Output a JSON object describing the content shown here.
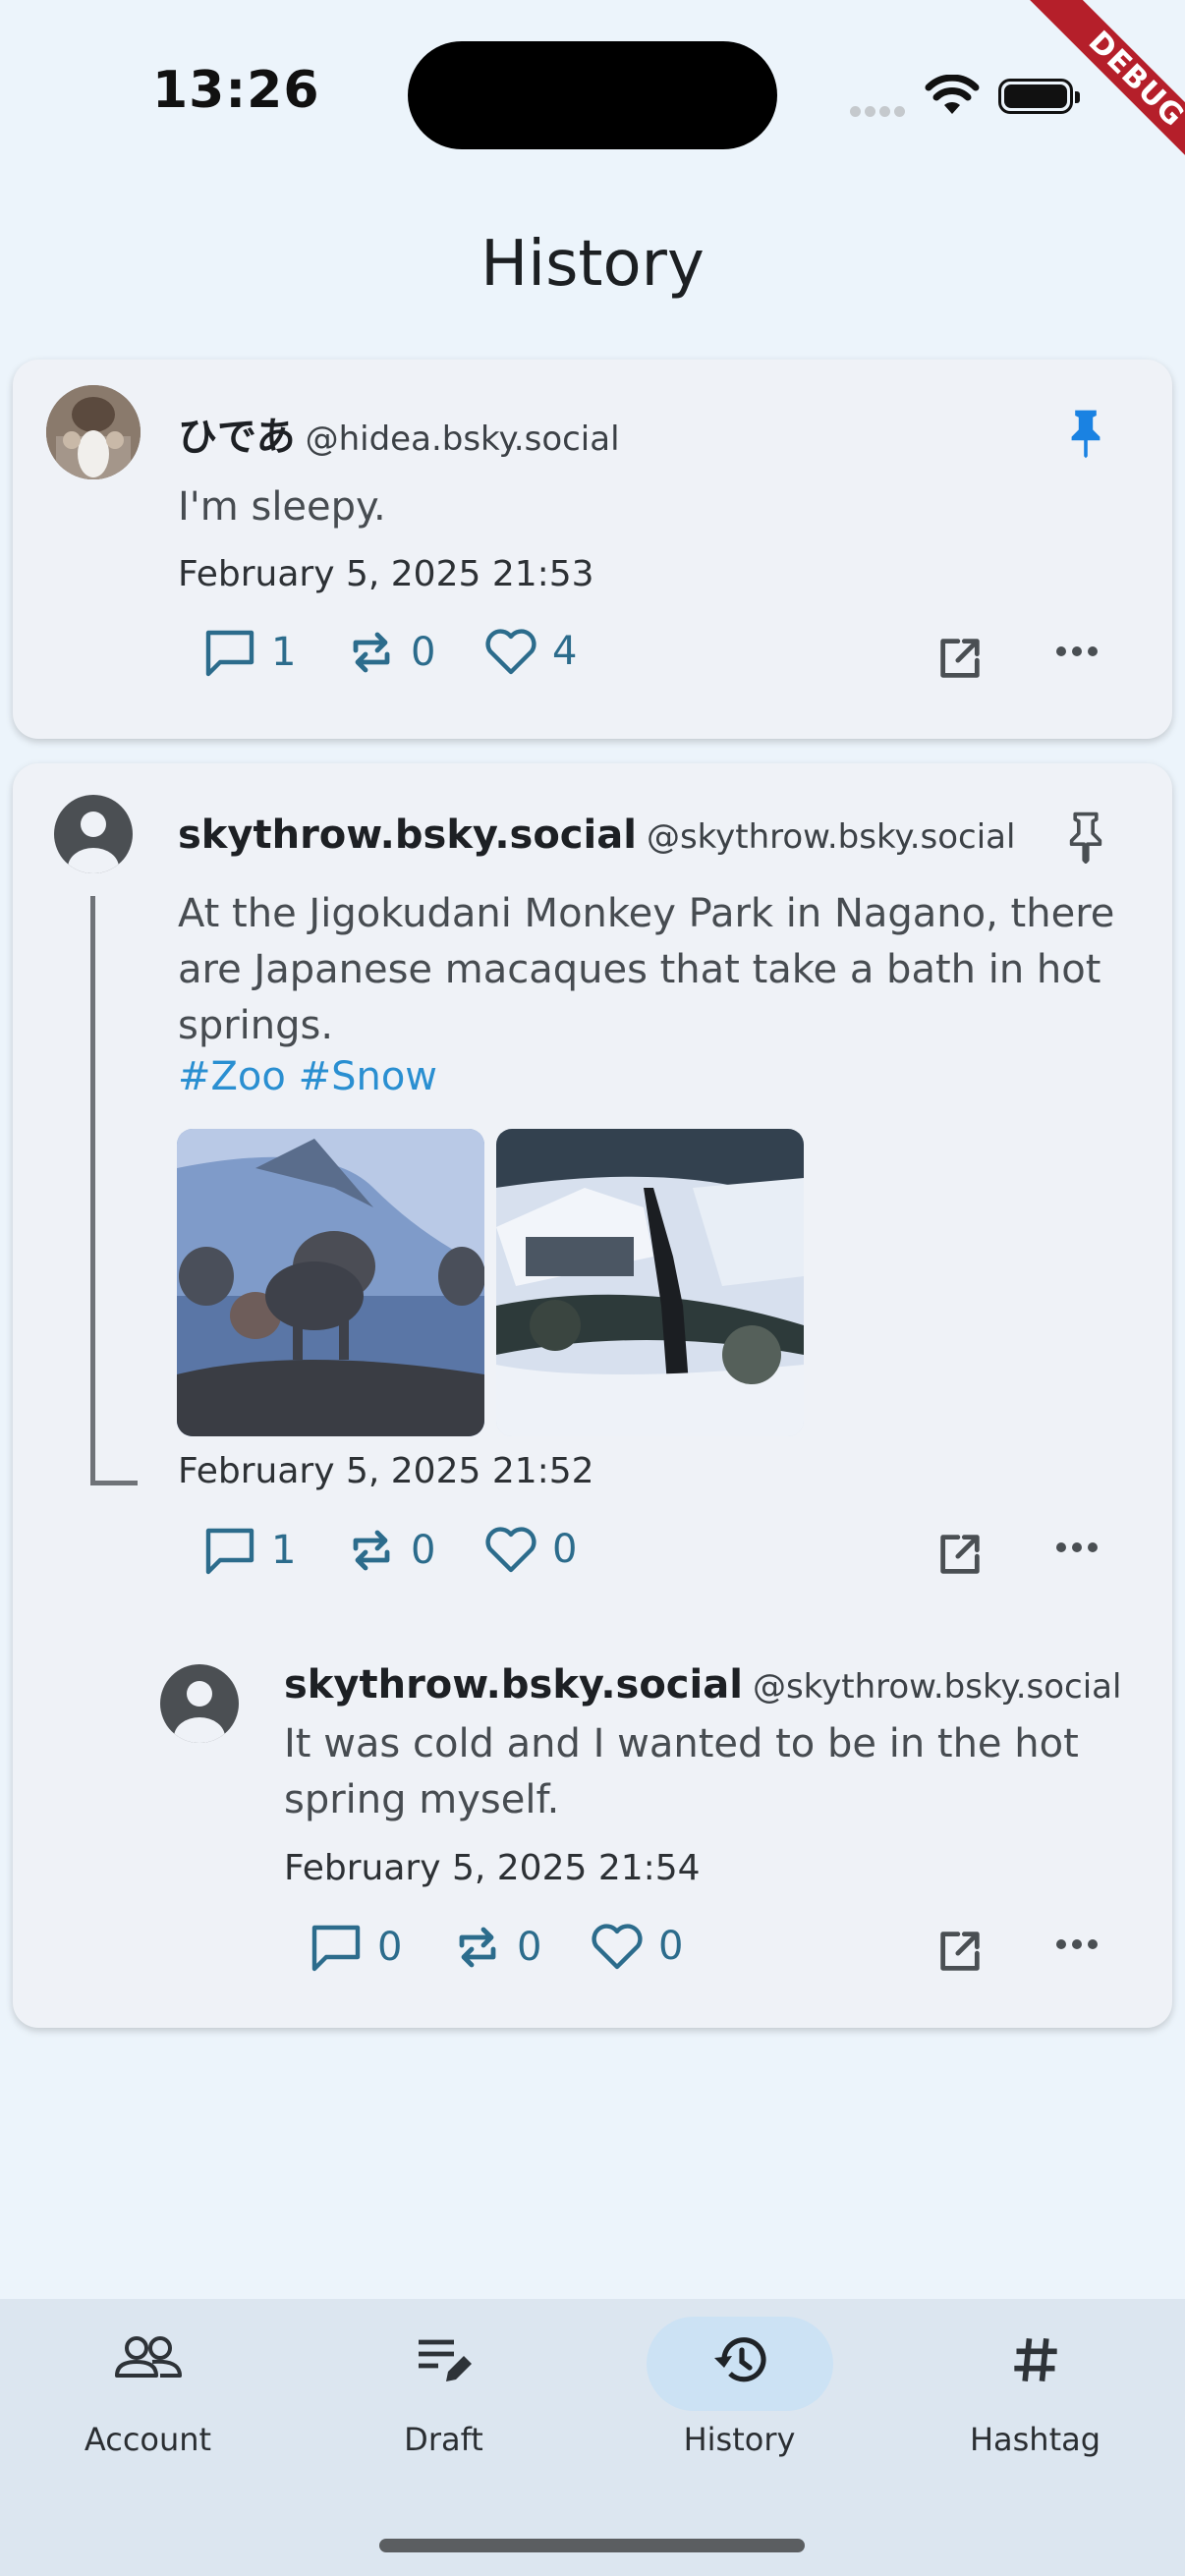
{
  "status_bar": {
    "time": "13:26",
    "debug_label": "DEBUG"
  },
  "header": {
    "title": "History"
  },
  "posts": [
    {
      "display_name": "ひであ",
      "handle": "@hidea.bsky.social",
      "text": "I'm sleepy.",
      "date": "February 5, 2025 21:53",
      "replies": "1",
      "reposts": "0",
      "likes": "4",
      "pinned": true
    },
    {
      "display_name": "skythrow.bsky.social",
      "handle": "@skythrow.bsky.social",
      "text": "At the Jigokudani Monkey Park in Nagano, there are Japanese macaques that take a bath in hot springs.",
      "tags": "#Zoo #Snow",
      "date": "February 5, 2025 21:52",
      "replies": "1",
      "reposts": "0",
      "likes": "0",
      "pinned": false,
      "images": [
        "monkeys-in-hot-spring",
        "snowy-onsen-valley"
      ],
      "reply": {
        "display_name": "skythrow.bsky.social",
        "handle": "@skythrow.bsky.social",
        "text": "It was cold and I wanted to be in the hot spring myself.",
        "date": "February 5, 2025 21:54",
        "replies": "0",
        "reposts": "0",
        "likes": "0"
      }
    }
  ],
  "nav": [
    {
      "label": "Account",
      "icon": "people-icon"
    },
    {
      "label": "Draft",
      "icon": "draft-edit-icon"
    },
    {
      "label": "History",
      "icon": "history-icon",
      "active": true
    },
    {
      "label": "Hashtag",
      "icon": "hashtag-icon"
    }
  ],
  "colors": {
    "accent": "#1a82e2",
    "action": "#2c6c8c",
    "tag": "#2a8fd1",
    "background": "#ecf4fb",
    "card": "#eff2f7"
  }
}
